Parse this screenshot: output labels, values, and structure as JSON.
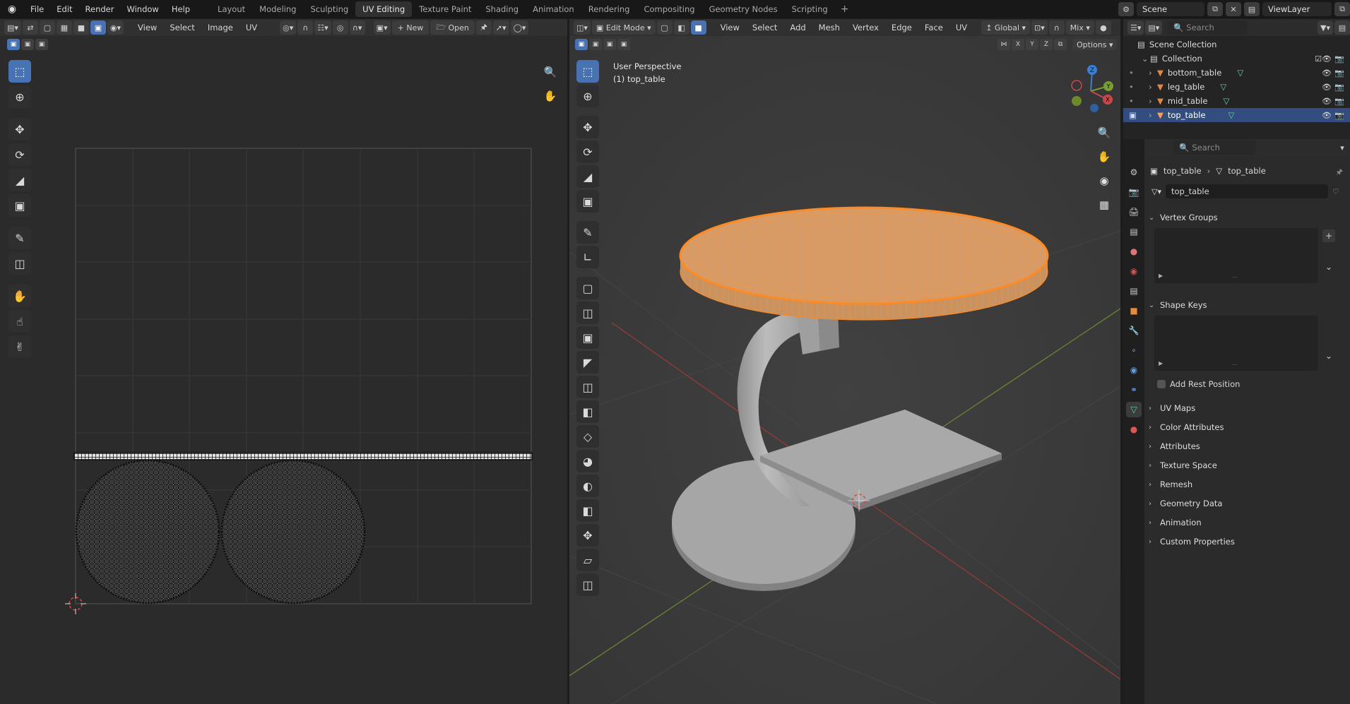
{
  "topbar": {
    "menu": [
      "File",
      "Edit",
      "Render",
      "Window",
      "Help"
    ],
    "workspaces": [
      "Layout",
      "Modeling",
      "Sculpting",
      "UV Editing",
      "Texture Paint",
      "Shading",
      "Animation",
      "Rendering",
      "Compositing",
      "Geometry Nodes",
      "Scripting"
    ],
    "active_workspace": "UV Editing",
    "scene": "Scene",
    "view_layer": "ViewLayer"
  },
  "uv_editor": {
    "header": {
      "menus": [
        "View",
        "Select",
        "Image",
        "UV"
      ],
      "new_label": "New",
      "open_label": "Open"
    },
    "tools_icons": [
      "select-box-icon",
      "cursor-icon",
      "move-icon",
      "rotate-icon",
      "scale-icon",
      "transform-icon",
      "annotate-icon",
      "rip-icon",
      "grab-icon",
      "relax-icon",
      "pinch-icon"
    ]
  },
  "viewport": {
    "header": {
      "mode": "Edit Mode",
      "menus": [
        "View",
        "Select",
        "Add",
        "Mesh",
        "Vertex",
        "Edge",
        "Face",
        "UV"
      ],
      "orientation": "Global",
      "mix": "Mix",
      "options_label": "Options"
    },
    "overlay": {
      "perspective": "User Perspective",
      "object_label": "(1) top_table"
    },
    "axes": {
      "x": "X",
      "y": "Y",
      "z": "Z"
    },
    "colors": {
      "selection": "#ff8a1f",
      "x_axis": "#c8474a",
      "y_axis": "#77a12c",
      "z_axis": "#3a7fd6"
    }
  },
  "outliner": {
    "search_placeholder": "Search",
    "scene_collection": "Scene Collection",
    "collection": "Collection",
    "objects": [
      "bottom_table",
      "leg_table",
      "mid_table",
      "top_table"
    ],
    "selected_object": "top_table"
  },
  "properties": {
    "search_placeholder": "Search",
    "breadcrumb_object": "top_table",
    "breadcrumb_mesh": "top_table",
    "mesh_name": "top_table",
    "sections_open": [
      "Vertex Groups",
      "Shape Keys"
    ],
    "add_rest_position": "Add Rest Position",
    "sections_closed": [
      "UV Maps",
      "Color Attributes",
      "Attributes",
      "Texture Space",
      "Remesh",
      "Geometry Data",
      "Animation",
      "Custom Properties"
    ]
  }
}
